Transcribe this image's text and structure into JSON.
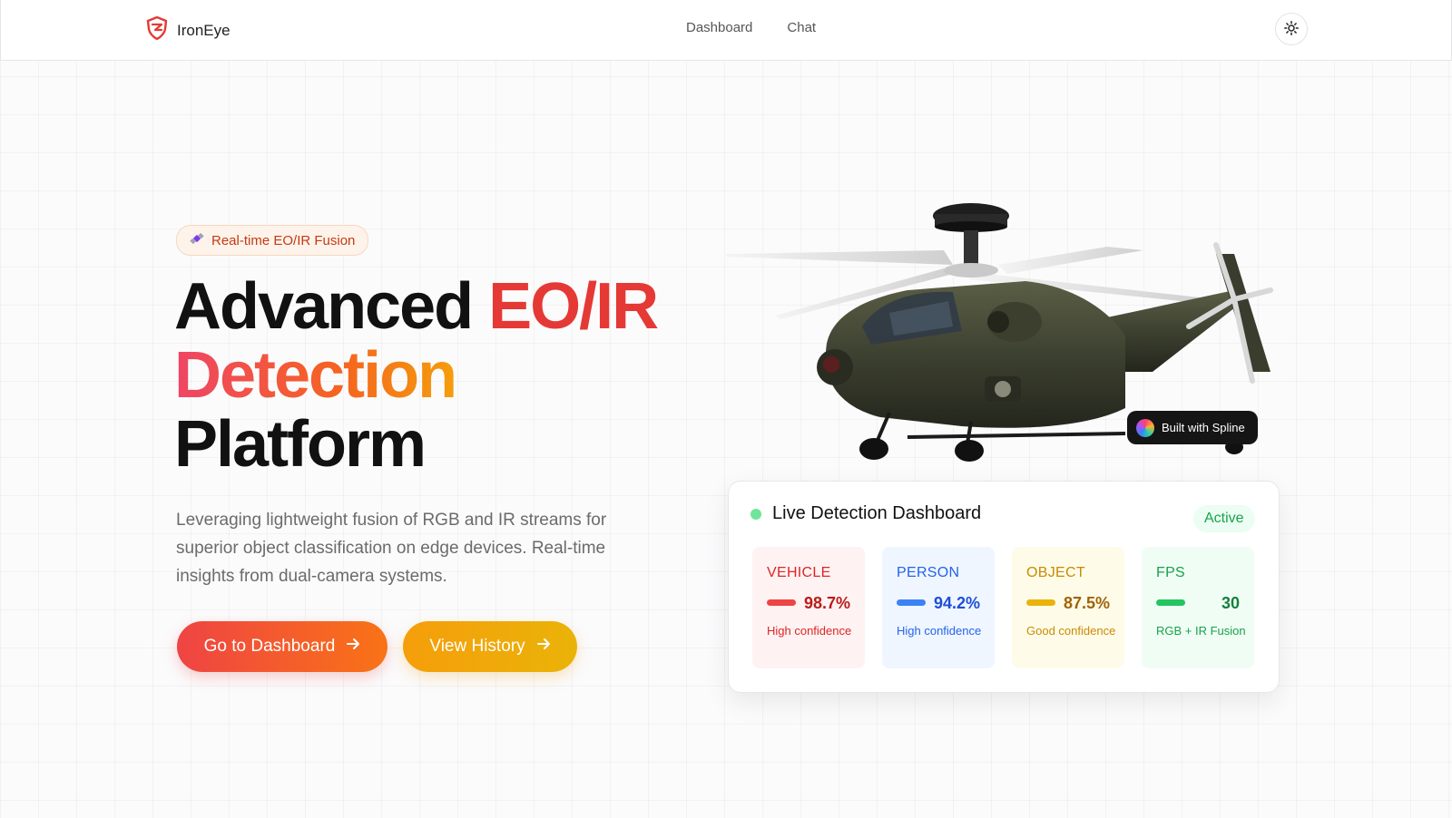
{
  "nav": {
    "brand": "IronEye",
    "links": [
      "Dashboard",
      "Chat"
    ],
    "icons": {
      "logo": "shield-logo-icon",
      "theme": "sun-icon"
    }
  },
  "hero": {
    "badge": "Real-time EO/IR Fusion",
    "headline": {
      "word1": "Advanced",
      "word2": "EO/IR",
      "word3": "Detection",
      "word4": "Platform"
    },
    "description": "Leveraging lightweight fusion of RGB and IR streams for superior object classification on edge devices. Real-time insights from dual-camera systems.",
    "primary_button": "Go to Dashboard",
    "secondary_button": "View History"
  },
  "spline_badge": "Built with Spline",
  "dashboard": {
    "title": "Live Detection Dashboard",
    "status": "Active",
    "metrics": [
      {
        "label": "VEHICLE",
        "value": "98.7%",
        "level": 0.987,
        "note": "High confidence",
        "color": "#ef4444"
      },
      {
        "label": "PERSON",
        "value": "94.2%",
        "level": 0.942,
        "note": "High confidence",
        "color": "#3b82f6"
      },
      {
        "label": "OBJECT",
        "value": "87.5%",
        "level": 0.875,
        "note": "Good confidence",
        "color": "#eab308"
      },
      {
        "label": "FPS",
        "value": "30",
        "note": "RGB + IR Fusion",
        "color": "#22c55e"
      }
    ]
  },
  "colors": {
    "accent_red": "#e53935",
    "accent_orange": "#f97316",
    "accent_amber": "#f59e0b",
    "live_green": "#4ade80"
  }
}
